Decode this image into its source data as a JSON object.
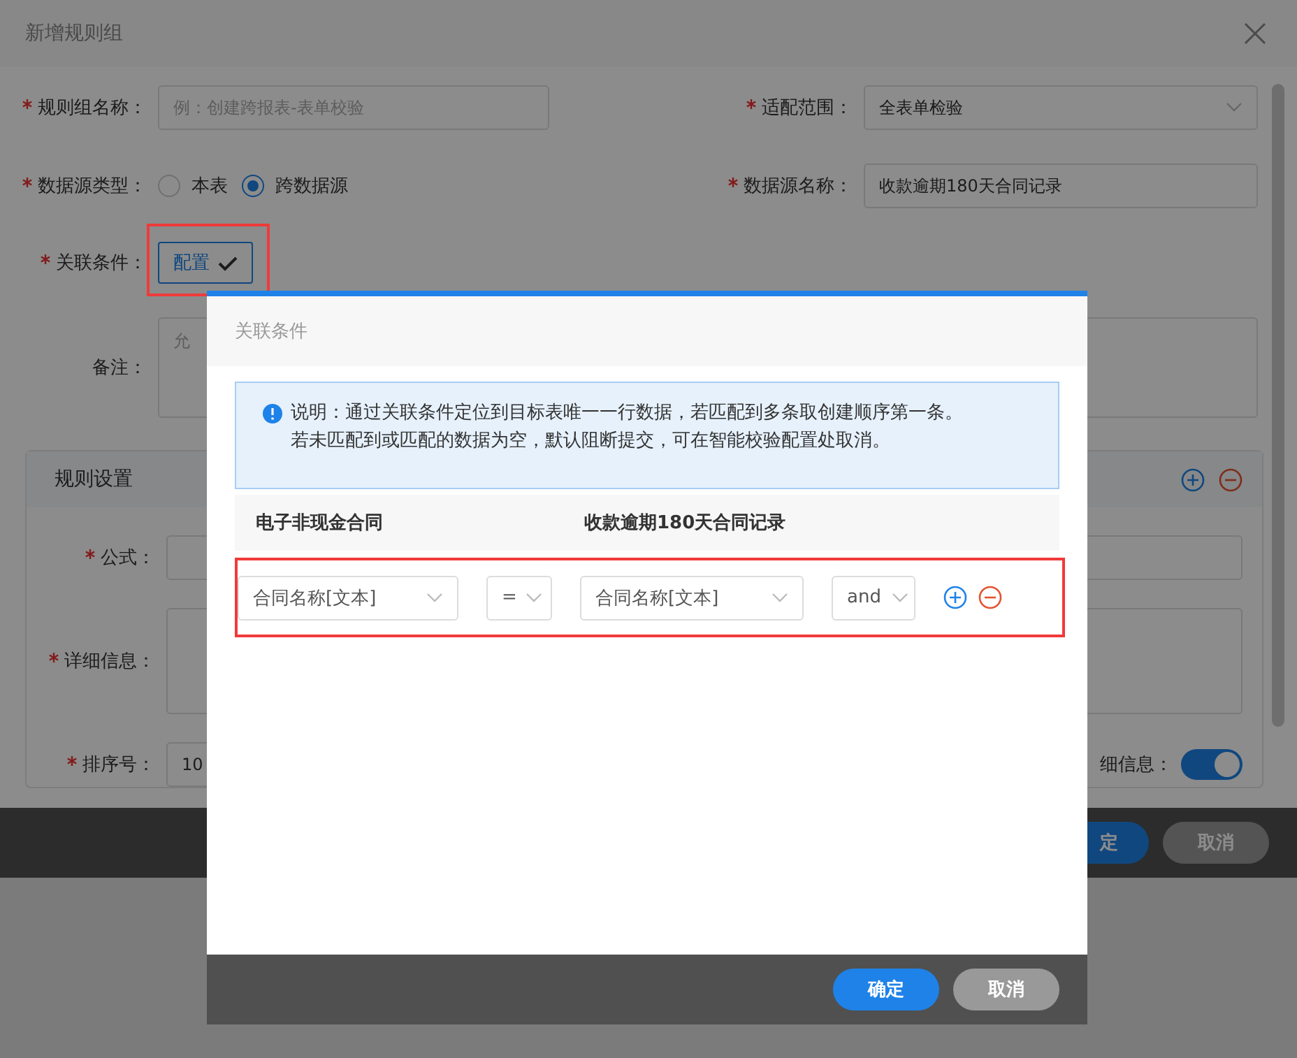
{
  "dialog": {
    "title": "新增规则组",
    "form": {
      "group_name": {
        "label": "规则组名称：",
        "required": true,
        "placeholder": "例：创建跨报表-表单校验"
      },
      "scope": {
        "label": "适配范围：",
        "required": true,
        "value": "全表单检验"
      },
      "source_type": {
        "label": "数据源类型：",
        "required": true,
        "options": [
          {
            "label": "本表",
            "selected": false
          },
          {
            "label": "跨数据源",
            "selected": true
          }
        ]
      },
      "source_name": {
        "label": "数据源名称：",
        "required": true,
        "value": "收款逾期180天合同记录"
      },
      "relation": {
        "label": "关联条件：",
        "required": true,
        "button": "配置",
        "highlighted": true
      },
      "remark": {
        "label": "备注：",
        "required": false,
        "placeholder": "允"
      }
    },
    "rule_section": {
      "title": "规则设置",
      "rows": [
        {
          "label": "公式：",
          "required": true,
          "kind": "input"
        },
        {
          "label": "详细信息：",
          "required": true,
          "kind": "textarea"
        },
        {
          "label": "排序号：",
          "required": true,
          "kind": "input",
          "value": "10"
        }
      ],
      "toggle": {
        "label": "细信息：",
        "on": true
      }
    },
    "buttons": [
      {
        "label": "定",
        "kind": "primary"
      },
      {
        "label": "取消",
        "kind": "secondary"
      }
    ]
  },
  "modal": {
    "title": "关联条件",
    "notice": [
      "说明：通过关联条件定位到目标表唯一一行数据，若匹配到多条取创建顺序第一条。",
      "若未匹配到或匹配的数据为空，默认阻断提交，可在智能校验配置处取消。"
    ],
    "columns": [
      "电子非现金合同",
      "收款逾期180天合同记录"
    ],
    "conditions": [
      {
        "left": "合同名称[文本]",
        "operator": "=",
        "right": "合同名称[文本]",
        "joiner": "and",
        "highlighted": true
      }
    ],
    "buttons": [
      {
        "label": "确定",
        "kind": "primary"
      },
      {
        "label": "取消",
        "kind": "secondary"
      }
    ]
  }
}
